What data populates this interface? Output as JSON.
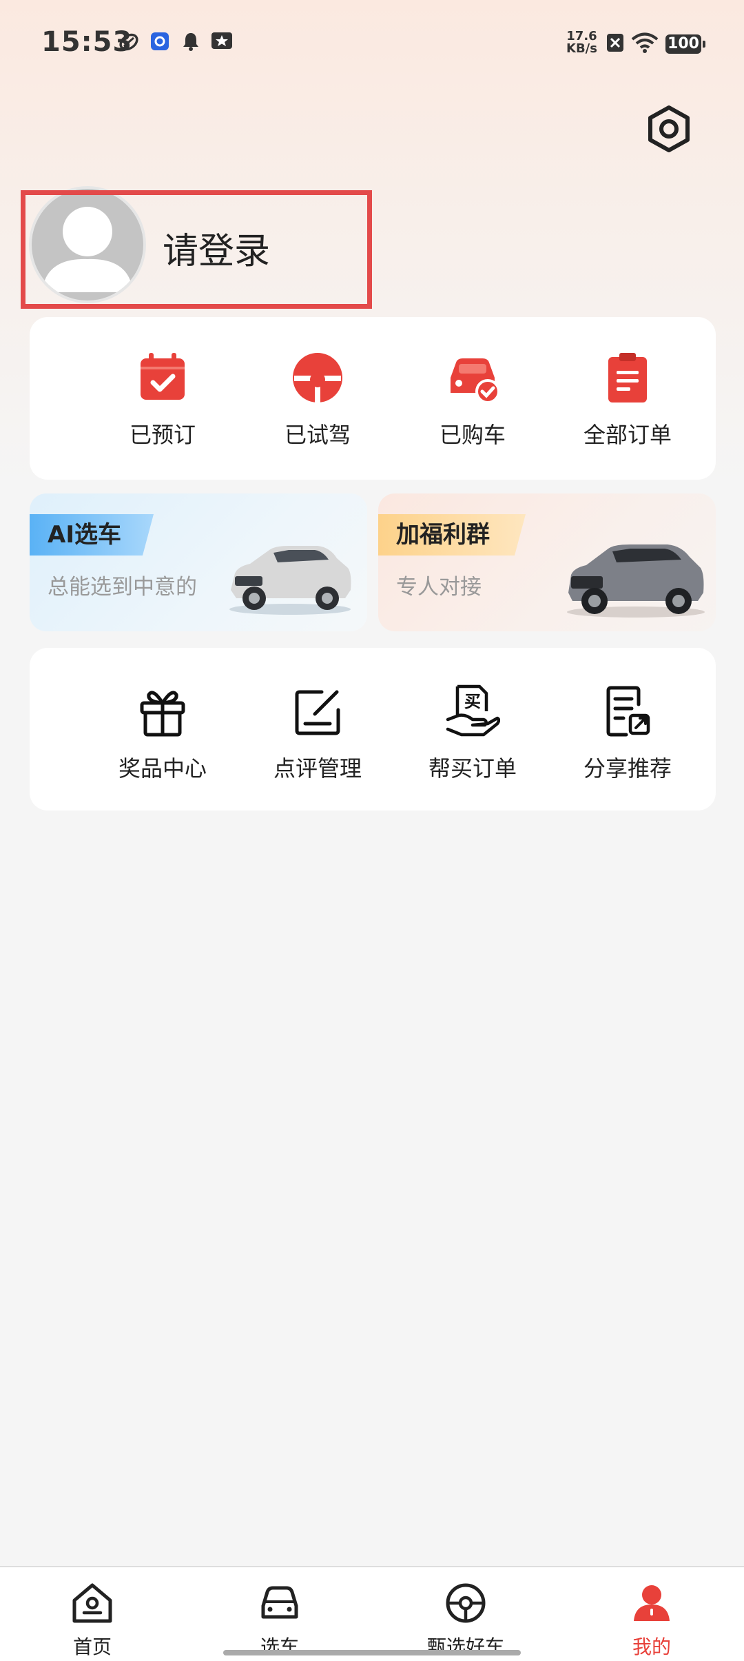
{
  "status_bar": {
    "time": "15:53",
    "net_speed_value": "17.6",
    "net_speed_unit": "KB/s",
    "battery": "100"
  },
  "profile": {
    "login_prompt": "请登录"
  },
  "orders": [
    {
      "label": "已预订",
      "icon": "calendar-check-icon"
    },
    {
      "label": "已试驾",
      "icon": "steering-wheel-icon"
    },
    {
      "label": "已购车",
      "icon": "car-check-icon"
    },
    {
      "label": "全部订单",
      "icon": "clipboard-icon"
    }
  ],
  "promos": [
    {
      "tag": "AI选车",
      "subtitle": "总能选到中意的"
    },
    {
      "tag": "加福利群",
      "subtitle": "专人对接"
    }
  ],
  "services": [
    {
      "label": "奖品中心",
      "icon": "gift-icon"
    },
    {
      "label": "点评管理",
      "icon": "edit-icon"
    },
    {
      "label": "帮买订单",
      "icon": "buy-hand-icon"
    },
    {
      "label": "分享推荐",
      "icon": "share-doc-icon"
    }
  ],
  "service_buy_glyph": "买",
  "bottom_nav": [
    {
      "label": "首页",
      "active": false
    },
    {
      "label": "选车",
      "active": false
    },
    {
      "label": "甄选好车",
      "active": false
    },
    {
      "label": "我的",
      "active": true
    }
  ],
  "colors": {
    "accent_red": "#e8413a",
    "active_tab": "#e8413a",
    "highlight_border": "#e34a4a"
  }
}
